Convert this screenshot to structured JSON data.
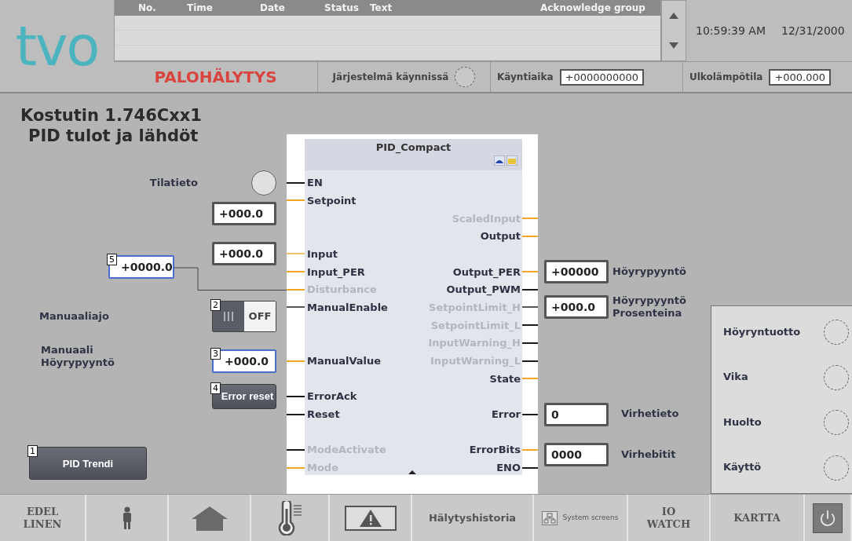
{
  "logo": "tvo",
  "alarm_view": {
    "columns": [
      "No.",
      "Time",
      "Date",
      "Status",
      "Text",
      "Acknowledge group"
    ]
  },
  "clock": {
    "time": "10:59:39 AM",
    "date": "12/31/2000"
  },
  "alarm_title": "PALOHÄLYTYS",
  "system_running": {
    "label": "Järjestelmä käynnissä",
    "on": false
  },
  "runtime": {
    "label": "Käyntiaika",
    "value": "+0000000000"
  },
  "outdoor_temp": {
    "label": "Ulkolämpötila",
    "value": "+000.000"
  },
  "title": "Kostutin 1.746Cxx1",
  "subtitle": "PID tulot ja lähdöt",
  "status_lamp": {
    "label": "Tilatieto",
    "on": false
  },
  "setpoint_field": {
    "value": "+000.0"
  },
  "input_field": {
    "value": "+000.0"
  },
  "disturbance_field": {
    "value": "+0000.0",
    "badge": "5",
    "color": "#4a6fc8"
  },
  "manual_mode": {
    "label": "Manuaaliajo",
    "badge": "2",
    "toggle_text": "OFF",
    "on": false
  },
  "manual_value": {
    "label": "Manuaali Höyrypyyntö",
    "value": "+000.0",
    "badge": "3",
    "color": "#4a6fc8"
  },
  "error_reset": {
    "label": "Error reset",
    "badge": "4"
  },
  "pid_trend": {
    "label": "PID Trendi",
    "badge": "1"
  },
  "pid_block": {
    "title": "PID_Compact",
    "inputs": [
      {
        "label": "EN",
        "color": "#1a1a1a",
        "dimmed": false
      },
      {
        "label": "Setpoint",
        "color": "#f5a623",
        "dimmed": false
      },
      {
        "label": "Input",
        "color": "#f5c26b",
        "dimmed": false
      },
      {
        "label": "Input_PER",
        "color": "#f5a623",
        "dimmed": false
      },
      {
        "label": "Disturbance",
        "color": "#f5a623",
        "dimmed": true
      },
      {
        "label": "ManualEnable",
        "color": "#555555",
        "dimmed": false
      },
      {
        "label": "ManualValue",
        "color": "#f5a623",
        "dimmed": false
      },
      {
        "label": "ErrorAck",
        "color": "#1a1a1a",
        "dimmed": false
      },
      {
        "label": "Reset",
        "color": "#1a1a1a",
        "dimmed": false
      },
      {
        "label": "ModeActivate",
        "color": "#1a1a1a",
        "dimmed": true
      },
      {
        "label": "Mode",
        "color": "#f5a623",
        "dimmed": true
      }
    ],
    "outputs": [
      {
        "label": "ScaledInput",
        "color": "#f5a623",
        "dimmed": true
      },
      {
        "label": "Output",
        "color": "#f5a623",
        "dimmed": false
      },
      {
        "label": "Output_PER",
        "color": "#f5a623",
        "dimmed": false
      },
      {
        "label": "Output_PWM",
        "color": "#1a1a1a",
        "dimmed": false
      },
      {
        "label": "SetpointLimit_H",
        "color": "#555555",
        "dimmed": true
      },
      {
        "label": "SetpointLimit_L",
        "color": "#1a1a1a",
        "dimmed": true
      },
      {
        "label": "InputWarning_H",
        "color": "#1a1a1a",
        "dimmed": true
      },
      {
        "label": "InputWarning_L",
        "color": "#1a1a1a",
        "dimmed": true
      },
      {
        "label": "State",
        "color": "#f5a623",
        "dimmed": false
      },
      {
        "label": "Error",
        "color": "#1a1a1a",
        "dimmed": false
      },
      {
        "label": "ErrorBits",
        "color": "#f5a623",
        "dimmed": false
      },
      {
        "label": "ENO",
        "color": "#1a1a1a",
        "dimmed": false
      }
    ]
  },
  "output_fields": [
    {
      "value": "+00000",
      "label": "Höyrypyyntö"
    },
    {
      "value": "+000.0",
      "label": "Höyrypyyntö Prosenteina"
    },
    {
      "value": "0",
      "label": "Virhetieto"
    },
    {
      "value": "0000",
      "label": "Virhebitit"
    }
  ],
  "status_panel": [
    {
      "label": "Höyryntuotto",
      "on": false
    },
    {
      "label": "Vika",
      "on": false
    },
    {
      "label": "Huolto",
      "on": false
    },
    {
      "label": "Käyttö",
      "on": false
    }
  ],
  "footer": [
    {
      "kind": "serif",
      "label": "EDEL LINEN"
    },
    {
      "kind": "icon"
    },
    {
      "kind": "icon"
    },
    {
      "kind": "icon"
    },
    {
      "kind": "icon"
    },
    {
      "kind": "sans",
      "label": "Hälytyshistoria"
    },
    {
      "kind": "small",
      "label": "System screens"
    },
    {
      "kind": "serif",
      "label": "IO WATCH"
    },
    {
      "kind": "serif",
      "label": "KARTTA"
    },
    {
      "kind": "icon"
    }
  ]
}
